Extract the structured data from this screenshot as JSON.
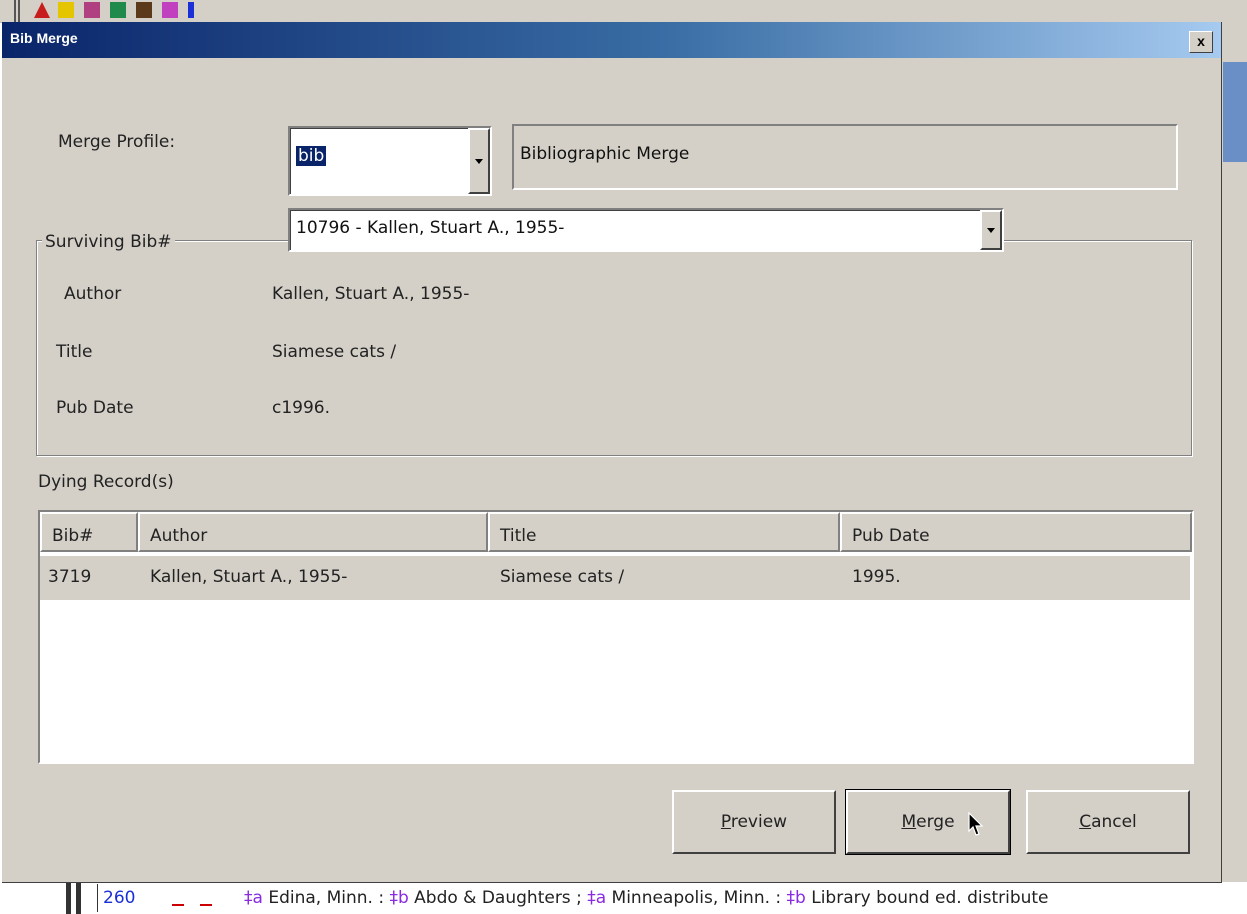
{
  "dialog": {
    "title": "Bib Merge",
    "close_label": "x"
  },
  "merge_profile": {
    "label": "Merge Profile:",
    "value": "bib",
    "description": "Bibliographic Merge"
  },
  "surviving": {
    "group_label": "Surviving Bib#",
    "selected": "10796 - Kallen, Stuart A., 1955-",
    "fields": [
      {
        "label": "Author",
        "value": "Kallen, Stuart A., 1955-"
      },
      {
        "label": "Title",
        "value": "Siamese cats /"
      },
      {
        "label": "Pub Date",
        "value": "c1996."
      }
    ]
  },
  "dying": {
    "label": "Dying Record(s)",
    "columns": [
      "Bib#",
      "Author",
      "Title",
      "Pub Date"
    ],
    "rows": [
      {
        "bib": "3719",
        "author": "Kallen, Stuart A., 1955-",
        "title": "Siamese cats /",
        "pubdate": "1995."
      }
    ]
  },
  "buttons": {
    "preview": {
      "mnemonic": "P",
      "rest": "review"
    },
    "merge": {
      "mnemonic": "M",
      "rest": "erge"
    },
    "cancel": {
      "mnemonic": "C",
      "rest": "ancel"
    }
  },
  "background": {
    "field_tag": "260",
    "field_parts": [
      {
        "sf": "‡a",
        "text": " Edina, Minn. : "
      },
      {
        "sf": "‡b",
        "text": " Abdo & Daughters ; "
      },
      {
        "sf": "‡a",
        "text": " Minneapolis, Minn. : "
      },
      {
        "sf": "‡b",
        "text": " Library bound ed. distribute"
      }
    ]
  },
  "colors": {
    "title_gradient_start": "#0a246a",
    "title_gradient_end": "#a6caf0",
    "selection": "#0a246a",
    "dialog_face": "#d4d0c8"
  }
}
